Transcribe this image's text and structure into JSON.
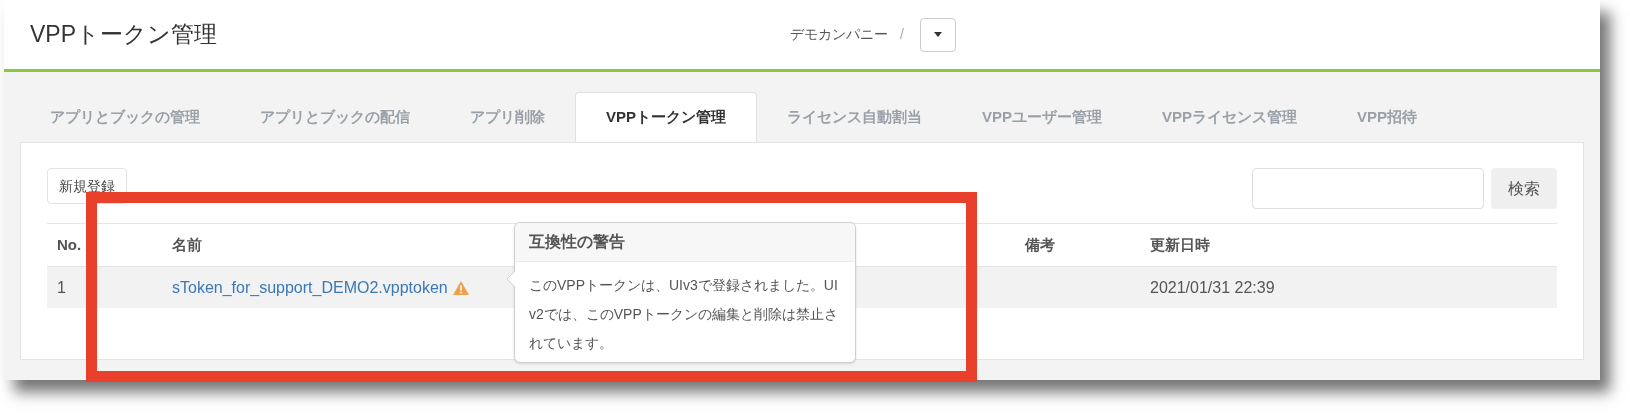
{
  "header": {
    "title": "VPPトークン管理",
    "company": "デモカンパニー",
    "separator": "/"
  },
  "tabs": [
    {
      "label": "アプリとブックの管理",
      "selected": false
    },
    {
      "label": "アプリとブックの配信",
      "selected": false
    },
    {
      "label": "アプリ削除",
      "selected": false
    },
    {
      "label": "VPPトークン管理",
      "selected": true
    },
    {
      "label": "ライセンス自動割当",
      "selected": false
    },
    {
      "label": "VPPユーザー管理",
      "selected": false
    },
    {
      "label": "VPPライセンス管理",
      "selected": false
    },
    {
      "label": "VPP招待",
      "selected": false
    }
  ],
  "new_button": "新規登録",
  "search_button": "検索",
  "table": {
    "columns": [
      "No.",
      "名前",
      "備考",
      "更新日時"
    ],
    "rows": [
      {
        "no": "1",
        "name": "sToken_for_support_DEMO2.vpptoken",
        "warning": true,
        "note": "",
        "updated": "2021/01/31 22:39"
      }
    ]
  },
  "tooltip": {
    "title": "互換性の警告",
    "body": "このVPPトークンは、UIv3で登録されました。UIv2では、このVPPトークンの編集と削除は禁止されています。"
  }
}
